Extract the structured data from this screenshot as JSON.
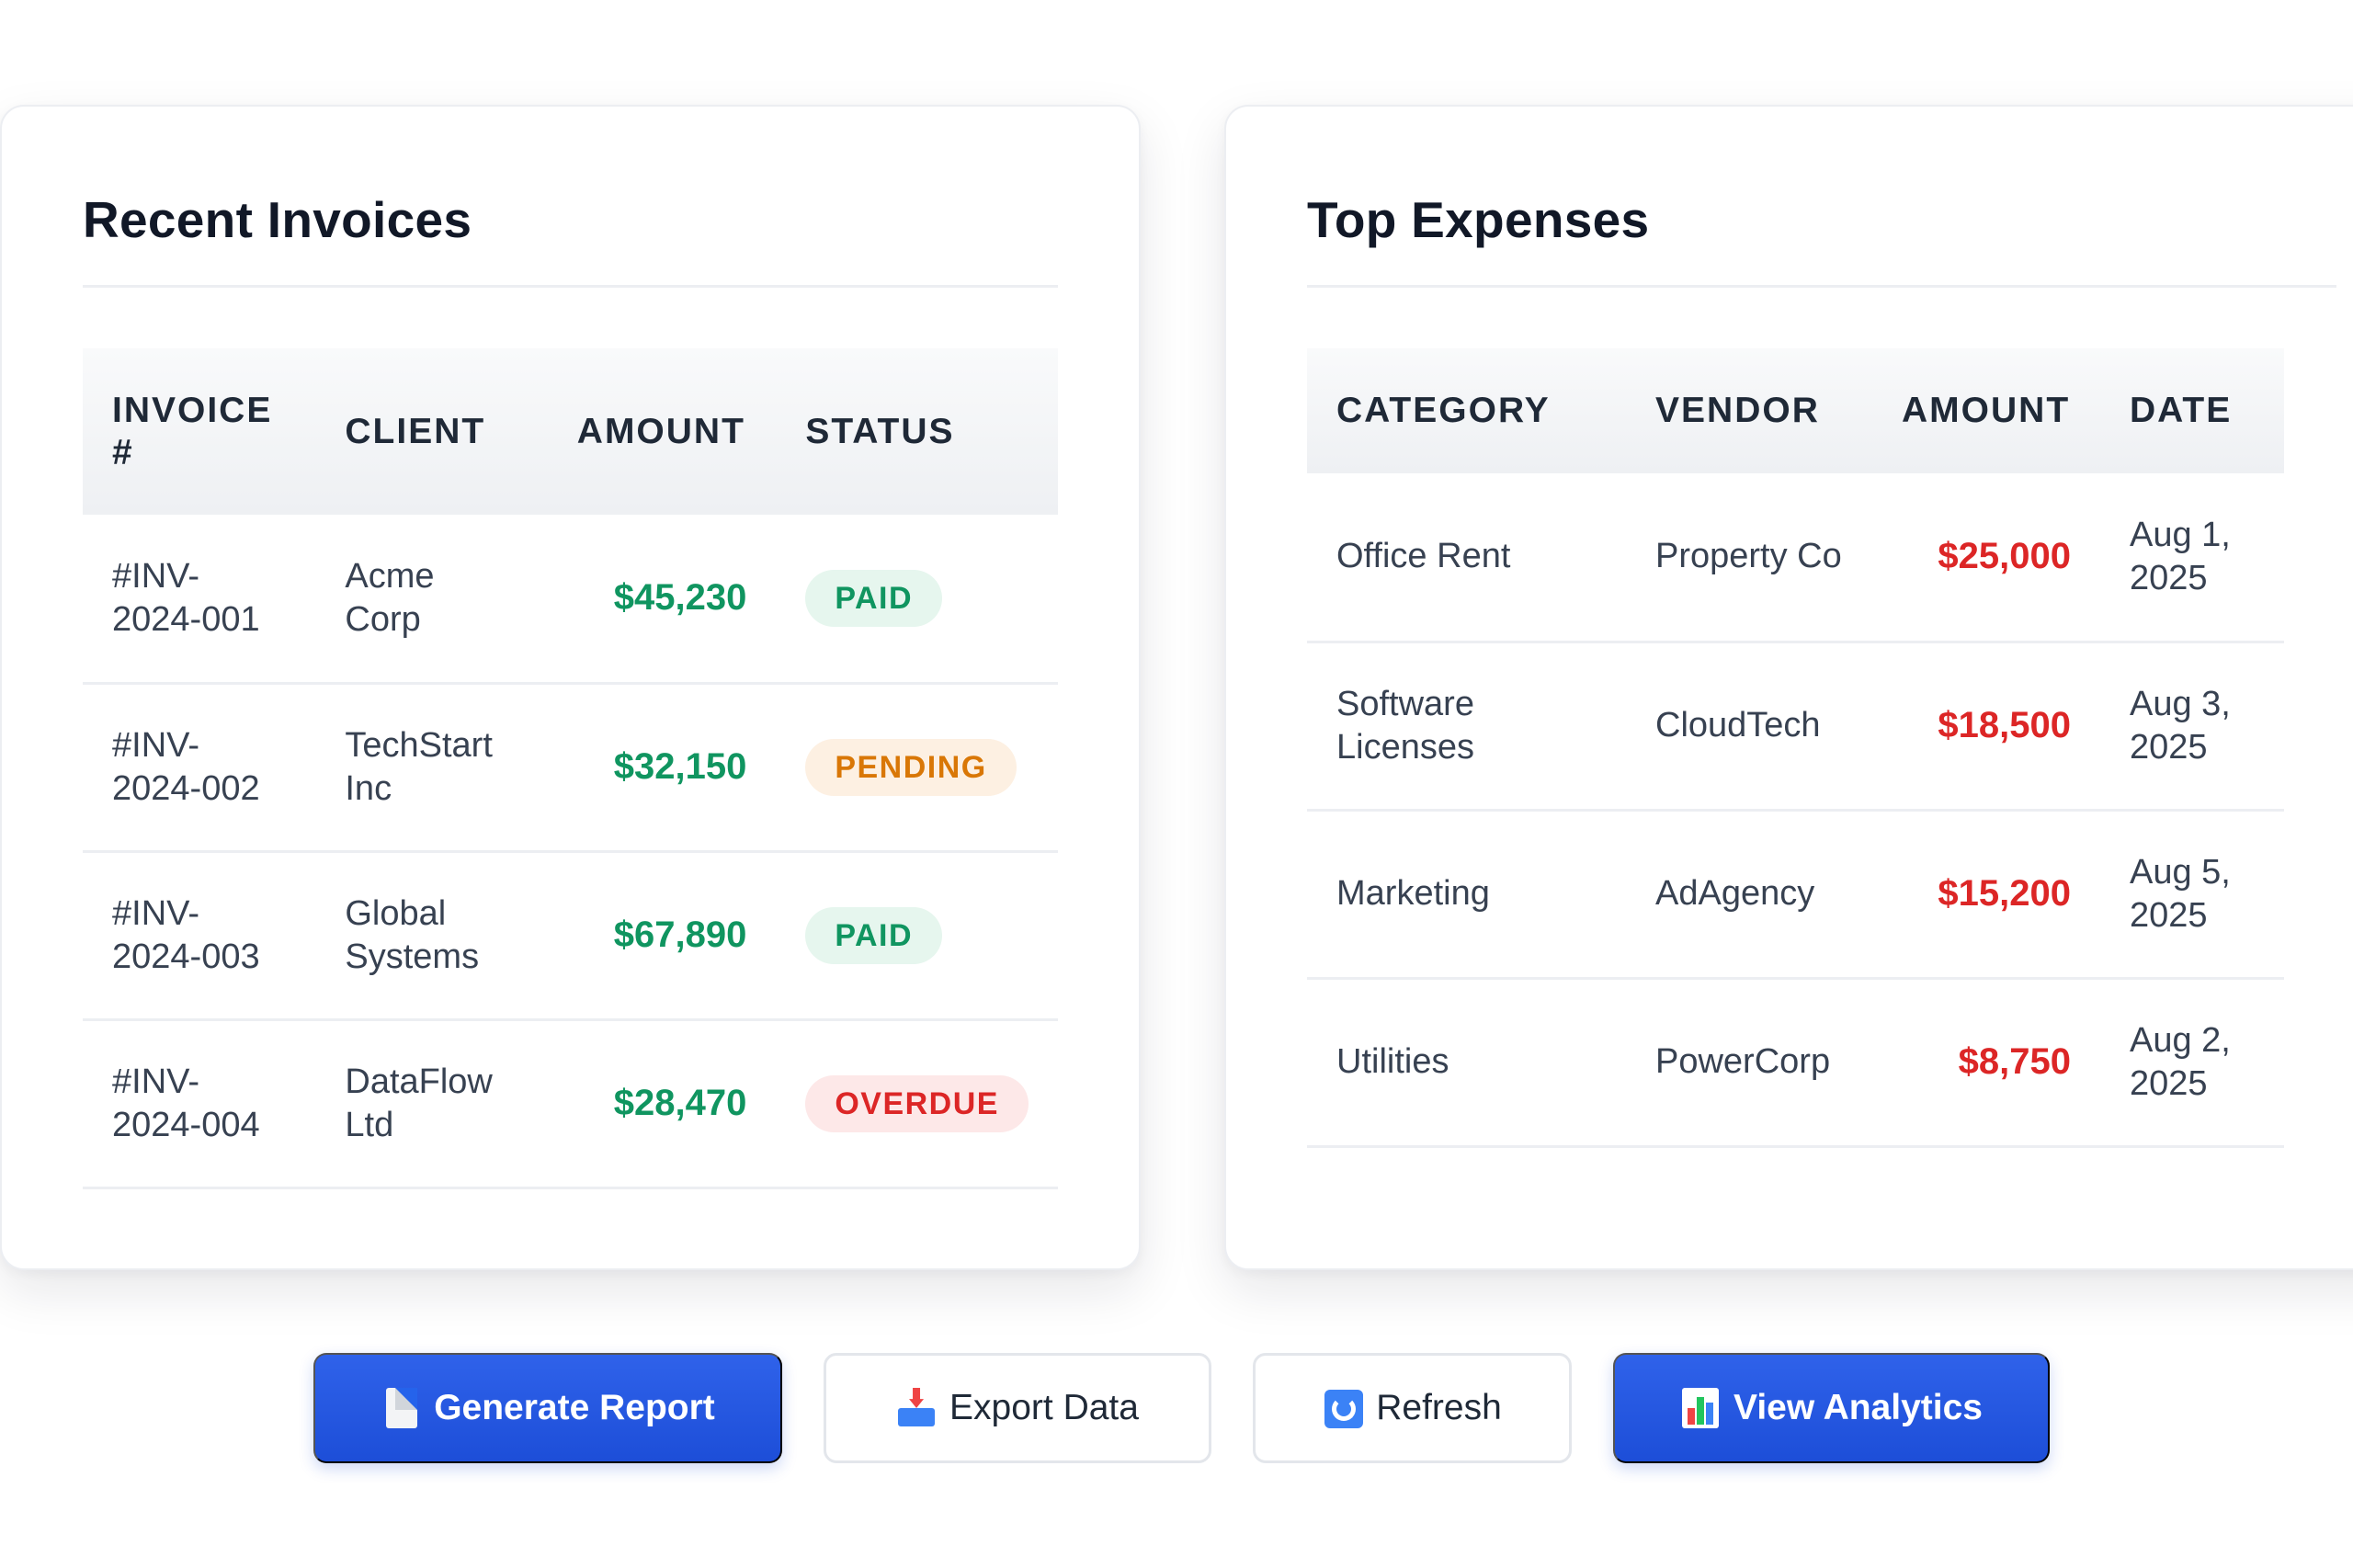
{
  "invoices": {
    "title": "Recent Invoices",
    "headers": [
      "INVOICE #",
      "CLIENT",
      "AMOUNT",
      "STATUS"
    ],
    "rows": [
      {
        "invoice": "#INV-2024-001",
        "client": "Acme Corp",
        "amount": "$45,230",
        "status": "PAID"
      },
      {
        "invoice": "#INV-2024-002",
        "client": "TechStart Inc",
        "amount": "$32,150",
        "status": "PENDING"
      },
      {
        "invoice": "#INV-2024-003",
        "client": "Global Systems",
        "amount": "$67,890",
        "status": "PAID"
      },
      {
        "invoice": "#INV-2024-004",
        "client": "DataFlow Ltd",
        "amount": "$28,470",
        "status": "OVERDUE"
      }
    ]
  },
  "expenses": {
    "title": "Top Expenses",
    "headers": [
      "CATEGORY",
      "VENDOR",
      "AMOUNT",
      "DATE"
    ],
    "rows": [
      {
        "category": "Office Rent",
        "vendor": "Property Co",
        "amount": "$25,000",
        "date": "Aug 1, 2025"
      },
      {
        "category": "Software Licenses",
        "vendor": "CloudTech",
        "amount": "$18,500",
        "date": "Aug 3, 2025"
      },
      {
        "category": "Marketing",
        "vendor": "AdAgency",
        "amount": "$15,200",
        "date": "Aug 5, 2025"
      },
      {
        "category": "Utilities",
        "vendor": "PowerCorp",
        "amount": "$8,750",
        "date": "Aug 2, 2025"
      }
    ]
  },
  "actions": {
    "generate_report": {
      "label": "Generate Report",
      "icon": "document-icon"
    },
    "export_data": {
      "label": "Export Data",
      "icon": "inbox-tray-icon"
    },
    "refresh": {
      "label": "Refresh",
      "icon": "refresh-icon"
    },
    "view_analytics": {
      "label": "View Analytics",
      "icon": "bar-chart-icon"
    }
  },
  "colors": {
    "accent": "#1d4ed8",
    "income": "#109560",
    "expense": "#dc2626",
    "pending": "#d97706"
  }
}
